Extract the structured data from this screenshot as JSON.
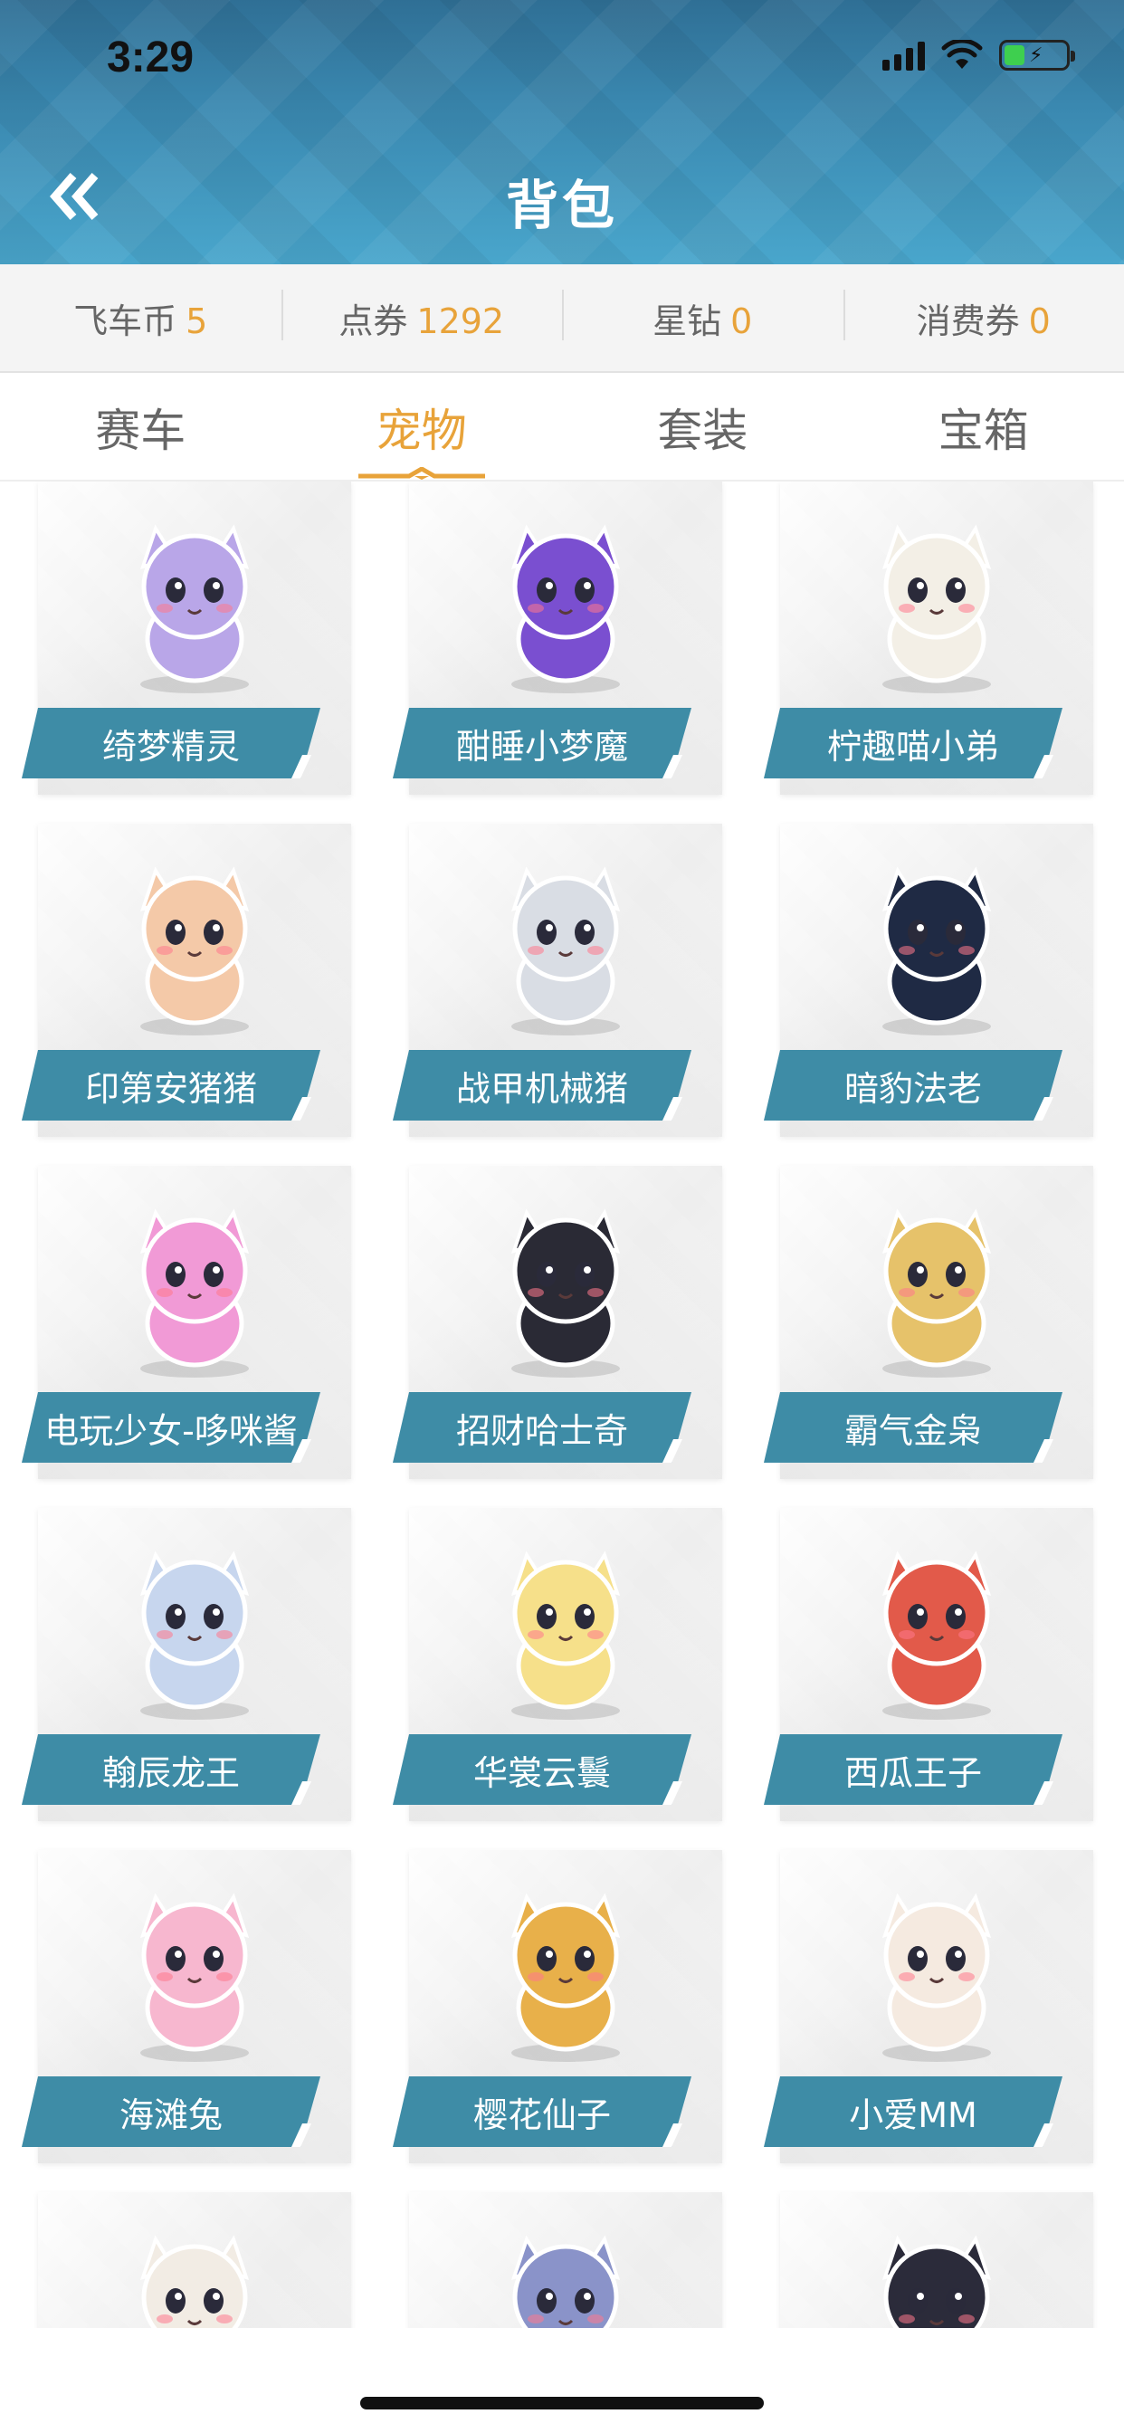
{
  "status_bar": {
    "time": "3:29",
    "signal_icon": "cellular-signal-icon",
    "wifi_icon": "wifi-icon",
    "battery_icon": "battery-charging-icon"
  },
  "header": {
    "back_icon": "double-chevron-left-icon",
    "title": "背包"
  },
  "currencies": [
    {
      "label": "飞车币",
      "value": "5"
    },
    {
      "label": "点券",
      "value": "1292"
    },
    {
      "label": "星钻",
      "value": "0"
    },
    {
      "label": "消费券",
      "value": "0"
    }
  ],
  "tabs": [
    {
      "label": "赛车",
      "active": false
    },
    {
      "label": "宠物",
      "active": true
    },
    {
      "label": "套装",
      "active": false
    },
    {
      "label": "宝箱",
      "active": false
    }
  ],
  "colors": {
    "accent": "#e8a33a",
    "plate": "#3e8ca6",
    "header": "#3a88b0"
  },
  "pets": [
    {
      "name": "绮梦精灵",
      "color": "#b9a6e8"
    },
    {
      "name": "酣睡小梦魔",
      "color": "#7a4fd0"
    },
    {
      "name": "柠趣喵小弟",
      "color": "#f3efe6"
    },
    {
      "name": "印第安猪猪",
      "color": "#f4c9a8"
    },
    {
      "name": "战甲机械猪",
      "color": "#d9dde4"
    },
    {
      "name": "暗豹法老",
      "color": "#1f2a44"
    },
    {
      "name": "电玩少女-哆咪酱",
      "color": "#f19ad6"
    },
    {
      "name": "招财哈士奇",
      "color": "#2a2a35"
    },
    {
      "name": "霸气金枭",
      "color": "#e6c26a"
    },
    {
      "name": "翰辰龙王",
      "color": "#c7d6ee"
    },
    {
      "name": "华裳云鬟",
      "color": "#f6e08a"
    },
    {
      "name": "西瓜王子",
      "color": "#e25a4a"
    },
    {
      "name": "海滩兔",
      "color": "#f7b7cf"
    },
    {
      "name": "樱花仙子",
      "color": "#e8b04a"
    },
    {
      "name": "小爱MM",
      "color": "#f5eae0"
    },
    {
      "name": "",
      "color": "#f2ece4"
    },
    {
      "name": "",
      "color": "#8a93c9"
    },
    {
      "name": "",
      "color": "#2b2b3a"
    }
  ]
}
